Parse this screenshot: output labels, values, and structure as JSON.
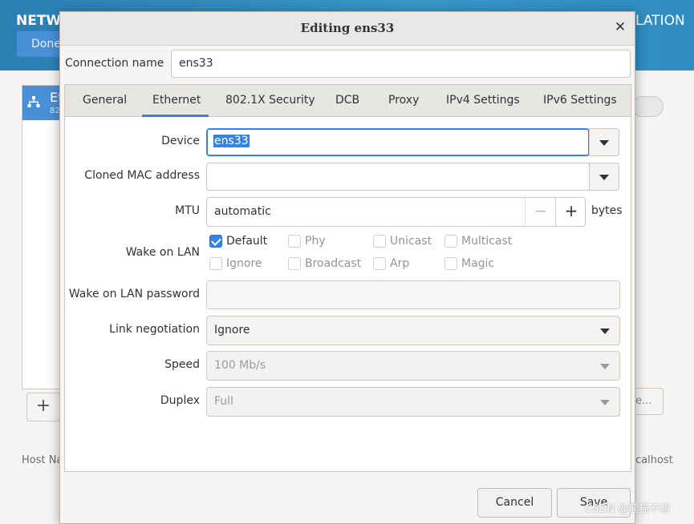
{
  "background_window": {
    "title_left": "NETW",
    "title_right": "LATION",
    "done_label": "Done",
    "list_item_name": "Et",
    "list_item_sub": "82",
    "add_label": "+",
    "host_name_label": "Host Na",
    "host_name_value": "calhost",
    "configure_label": "e..."
  },
  "dialog": {
    "title": "Editing ens33",
    "close_icon": "close-icon",
    "connection_name_label": "Connection name",
    "connection_name_value": "ens33",
    "tabs": [
      {
        "label": "General"
      },
      {
        "label": "Ethernet",
        "active": true
      },
      {
        "label": "802.1X Security"
      },
      {
        "label": "DCB"
      },
      {
        "label": "Proxy"
      },
      {
        "label": "IPv4 Settings"
      },
      {
        "label": "IPv6 Settings"
      }
    ],
    "ethernet": {
      "device_label": "Device",
      "device_value": "ens33",
      "cloned_mac_label": "Cloned MAC address",
      "cloned_mac_value": "",
      "mtu_label": "MTU",
      "mtu_value": "automatic",
      "mtu_unit": "bytes",
      "wol_label": "Wake on LAN",
      "wol_options": [
        {
          "label": "Default",
          "checked": true
        },
        {
          "label": "Phy",
          "checked": false
        },
        {
          "label": "Unicast",
          "checked": false
        },
        {
          "label": "Multicast",
          "checked": false
        },
        {
          "label": "Ignore",
          "checked": false
        },
        {
          "label": "Broadcast",
          "checked": false
        },
        {
          "label": "Arp",
          "checked": false
        },
        {
          "label": "Magic",
          "checked": false
        }
      ],
      "wol_password_label": "Wake on LAN password",
      "wol_password_value": "",
      "link_negotiation_label": "Link negotiation",
      "link_negotiation_value": "Ignore",
      "speed_label": "Speed",
      "speed_value": "100 Mb/s",
      "duplex_label": "Duplex",
      "duplex_value": "Full"
    },
    "cancel_label": "Cancel",
    "save_label": "Save"
  },
  "watermark": "CSDN @熊猫不想",
  "colors": {
    "accent": "#3584e4",
    "header_blue": "#2f8cc0"
  }
}
